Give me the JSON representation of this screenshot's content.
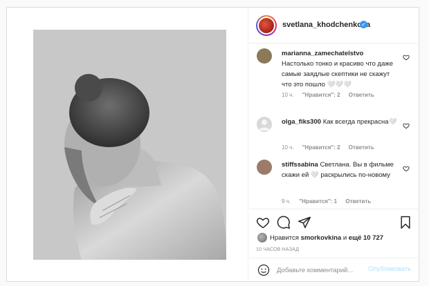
{
  "post": {
    "author": {
      "username": "svetlana_khodchenkova",
      "verified": true
    },
    "photo": {
      "description_icon": "photo-image",
      "style": "black-and-white portrait"
    }
  },
  "comments": [
    {
      "username": "marianna_zamechatelstvo",
      "text": "Настолько тонко и красиво что даже самые заядлые скептики не скажут что это пошло 🤍🤍🤍",
      "time": "10 ч.",
      "likes": "\"Нравится\": 2",
      "reply": "Ответить",
      "avatar_color": "#8a7a5a"
    },
    {
      "username": "olga_fiks300",
      "text": "Как всегда прекрасна🤍",
      "time": "10 ч.",
      "likes": "\"Нравится\": 2",
      "reply": "Ответить",
      "avatar_color": "#d8d8d8"
    },
    {
      "username": "stiffssabina",
      "text": "Светлана. Вы в фильме скажи ей 🤍 раскрылись по-новому",
      "time": "9 ч.",
      "likes": "\"Нравится\": 1",
      "reply": "Ответить",
      "avatar_color": "#9c7b6a"
    }
  ],
  "likes": {
    "prefix": "Нравится",
    "user": "smorkovkina",
    "conjunction": "и",
    "others": "ещё 10 727"
  },
  "timestamp": "10 ЧАСОВ НАЗАД",
  "add_comment": {
    "placeholder": "Добавьте комментарий...",
    "publish_label": "Опубликовать"
  },
  "colors": {
    "accent": "#3897f0",
    "publish_disabled": "#b2dffc",
    "muted": "#8e8e8e"
  }
}
